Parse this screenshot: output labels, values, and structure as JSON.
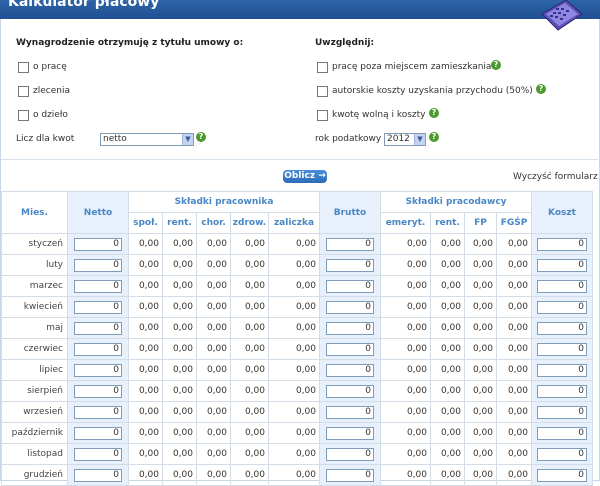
{
  "header": {
    "title": "Kalkulator płacowy"
  },
  "left_panel": {
    "title": "Wynagrodzenie otrzymuję z tytułu umowy o:",
    "options": [
      "o pracę",
      "zlecenia",
      "o dzieło"
    ],
    "liczdla_label": "Licz dla kwot",
    "liczdla_value": "netto",
    "help": "?"
  },
  "right_panel": {
    "title": "Uwzględnij:",
    "options": [
      "pracę poza miejscem zamieszkania",
      "autorskie koszty uzyskania przychodu (50%)",
      "kwotę wolną i koszty"
    ],
    "rok_label": "rok podatkowy",
    "rok_value": "2012",
    "help": "?"
  },
  "actions": {
    "oblicz": "Oblicz →",
    "clear": "Wyczyść formularz"
  },
  "table": {
    "headers": {
      "mies": "Mies.",
      "netto": "Netto",
      "pracownik": "Składki pracownika",
      "brutto": "Brutto",
      "pracodawca": "Składki pracodawcy",
      "koszt": "Koszt"
    },
    "subheaders": [
      "społ.",
      "rent.",
      "chor.",
      "zdrow.",
      "zaliczka",
      "emeryt.",
      "rent.",
      "FP",
      "FGŚP"
    ],
    "months": [
      "styczeń",
      "luty",
      "marzec",
      "kwiecień",
      "maj",
      "czerwiec",
      "lipiec",
      "sierpień",
      "wrzesień",
      "październik",
      "listopad",
      "grudzień"
    ],
    "input_value": "0",
    "cell_value": "0,00"
  }
}
